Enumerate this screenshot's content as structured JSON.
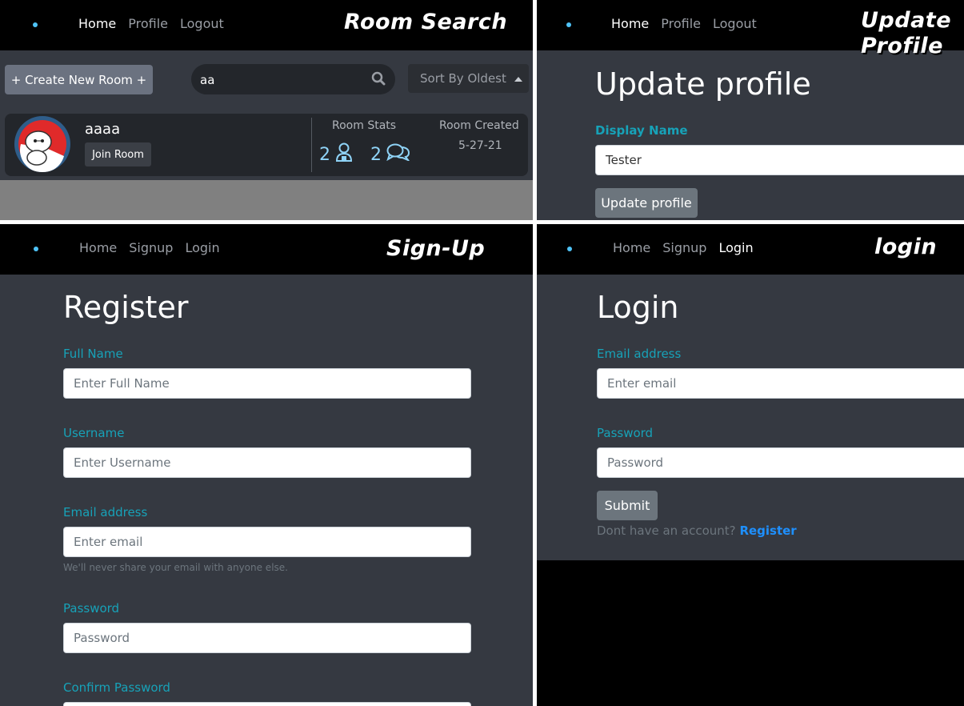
{
  "room_search": {
    "title": "Room Search",
    "nav": [
      "Home",
      "Profile",
      "Logout"
    ],
    "create_button": "+ Create New Room +",
    "search_value": "aa",
    "sort_button": "Sort By Oldest",
    "room": {
      "name": "aaaa",
      "join_button": "Join Room",
      "stats_label": "Room Stats",
      "users_count": "2",
      "messages_count": "2",
      "created_label": "Room Created",
      "created_date": "5-27-21"
    }
  },
  "update_profile": {
    "title": "Update Profile",
    "nav": [
      "Home",
      "Profile",
      "Logout"
    ],
    "heading": "Update profile",
    "display_name_label": "Display Name",
    "display_name_value": "Tester",
    "submit_button": "Update profile"
  },
  "signup": {
    "title": "Sign-Up",
    "nav": [
      "Home",
      "Signup",
      "Login"
    ],
    "heading": "Register",
    "full_name_label": "Full Name",
    "full_name_placeholder": "Enter Full Name",
    "username_label": "Username",
    "username_placeholder": "Enter Username",
    "email_label": "Email address",
    "email_placeholder": "Enter email",
    "email_help": "We'll never share your email with anyone else.",
    "password_label": "Password",
    "password_placeholder": "Password",
    "confirm_label": "Confirm Password"
  },
  "login": {
    "title": "login",
    "nav": [
      "Home",
      "Signup",
      "Login"
    ],
    "heading": "Login",
    "email_label": "Email address",
    "email_placeholder": "Enter email",
    "password_label": "Password",
    "password_placeholder": "Password",
    "submit_button": "Submit",
    "no_account_text": "Dont have an account?",
    "register_link": "Register"
  },
  "colors": {
    "panel_bg": "#353941",
    "navbar_bg": "#000000",
    "label_teal": "#17a2b8",
    "link_blue": "#1e90ff",
    "nav_dot": "#4fc3f7"
  }
}
